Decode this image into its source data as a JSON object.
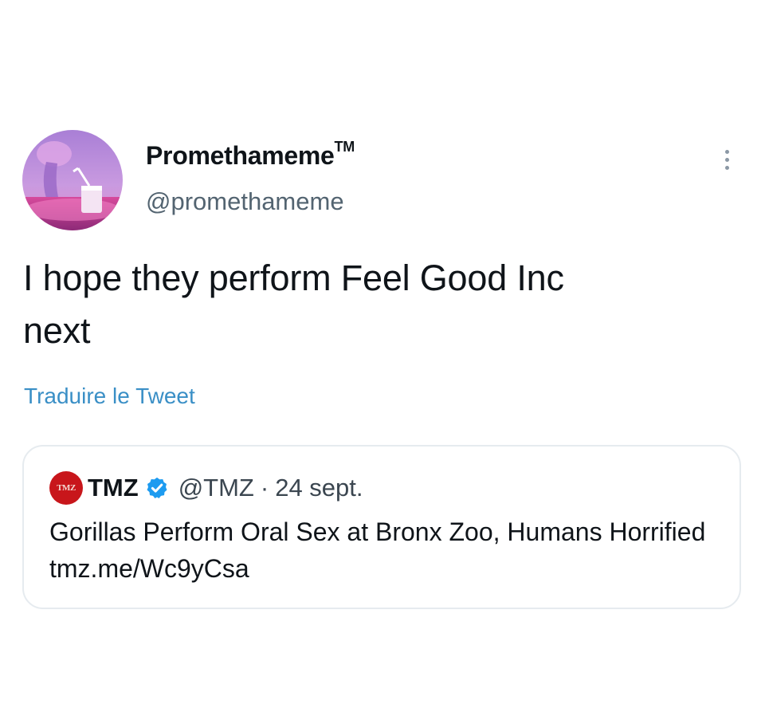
{
  "author": {
    "display_name": "Promethameme",
    "trademark": "TM",
    "handle": "@promethameme",
    "avatar_icon": "avatar-image"
  },
  "tweet": {
    "text_line1": "I hope they perform Feel Good Inc",
    "text_line2": "next",
    "translate_label": "Traduire le Tweet"
  },
  "quoted_tweet": {
    "avatar_text": "TMZ",
    "name": "TMZ",
    "verified_icon": "verified-badge-icon",
    "handle": "@TMZ",
    "separator": "·",
    "date": "24 sept.",
    "text": "Gorillas Perform Oral Sex at Bronx Zoo, Humans Horrified",
    "link": "tmz.me/Wc9yCsa"
  },
  "colors": {
    "link_blue": "#3a8fc6",
    "secondary_text": "#536471",
    "verified_blue": "#1d9bf0",
    "tmz_red": "#c8161b"
  }
}
